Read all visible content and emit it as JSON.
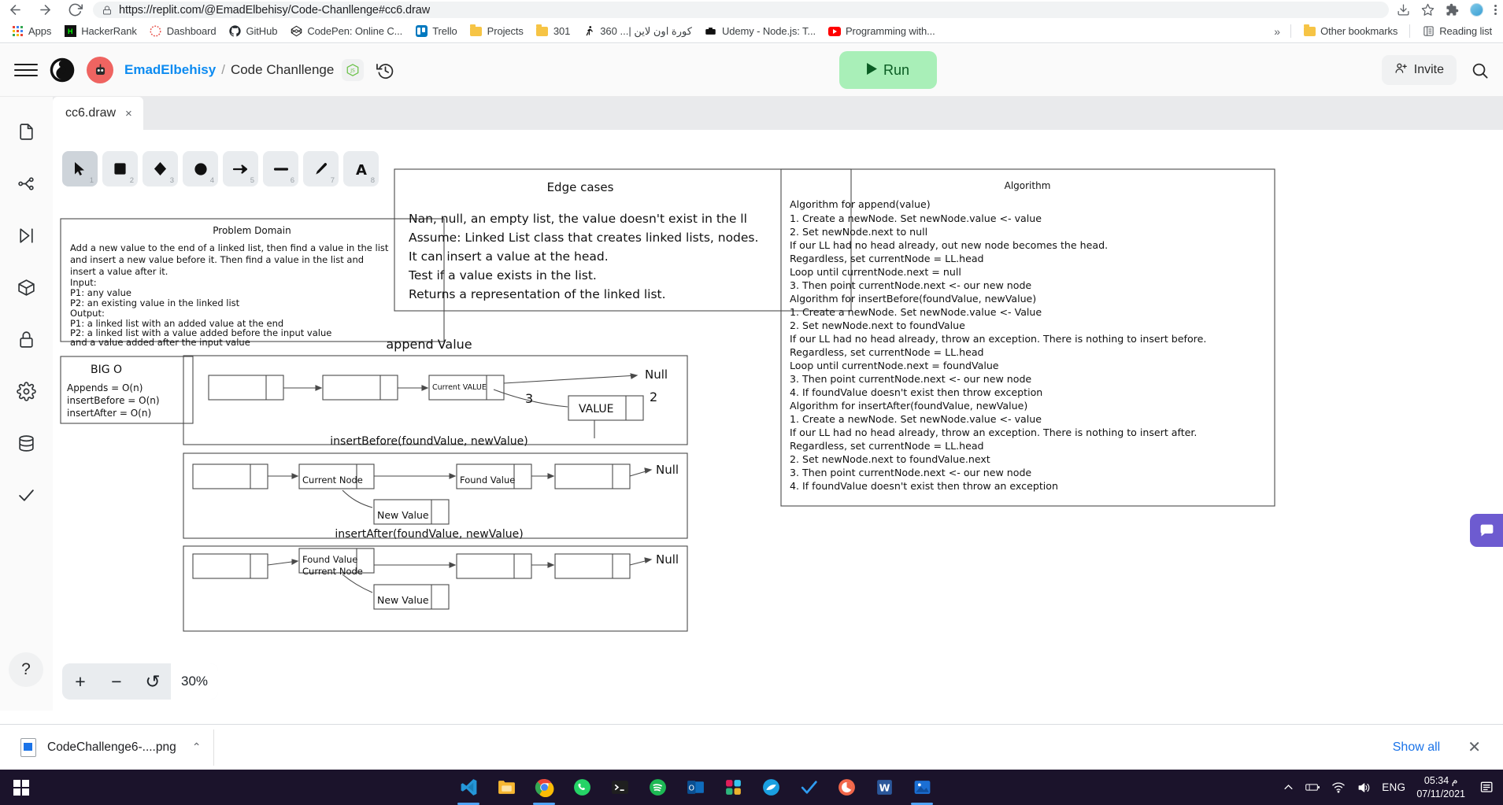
{
  "browser": {
    "url": "https://replit.com/@EmadElbehisy/Code-Chanllenge#cc6.draw",
    "back_label": "Back",
    "forward_label": "Forward",
    "reload_label": "Reload",
    "lock_icon": "lock-icon",
    "install_icon": "install-icon",
    "star_icon": "bookmark-star-icon",
    "extensions_icon": "extensions-puzzle-icon",
    "profile_icon": "profile-avatar",
    "menu_icon": "three-dot-menu-icon"
  },
  "bookmarks": {
    "items": [
      {
        "label": "Apps",
        "icon": "apps-grid-icon"
      },
      {
        "label": "HackerRank",
        "icon": "hackerrank-icon"
      },
      {
        "label": "Dashboard",
        "icon": "dashboard-icon"
      },
      {
        "label": "GitHub",
        "icon": "github-icon"
      },
      {
        "label": "CodePen: Online C...",
        "icon": "codepen-icon"
      },
      {
        "label": "Trello",
        "icon": "trello-icon"
      },
      {
        "label": "Projects",
        "icon": "folder-icon"
      },
      {
        "label": "301",
        "icon": "folder-icon"
      },
      {
        "label": "كورة اون لاين |... 360",
        "icon": "kora-icon"
      },
      {
        "label": "Udemy - Node.js: T...",
        "icon": "udemy-icon"
      },
      {
        "label": "Programming with...",
        "icon": "youtube-icon"
      }
    ],
    "overflow_label": "»",
    "other_bookmarks": {
      "label": "Other bookmarks",
      "icon": "folder-icon"
    },
    "reading_list": {
      "label": "Reading list",
      "icon": "reading-list-icon"
    }
  },
  "replit_header": {
    "menu_icon": "hamburger-menu-icon",
    "logo_icon": "replit-logo-icon",
    "avatar_icon": "user-avatar",
    "user": "EmadElbehisy",
    "separator": "/",
    "project": "Code Chanllenge",
    "language_badge": "nodejs-badge-icon",
    "history_icon": "history-icon",
    "run_label": "Run",
    "run_icon": "play-icon",
    "run_color": "#a9efb8",
    "invite_label": "Invite",
    "invite_icon": "add-person-icon",
    "search_icon": "search-icon"
  },
  "sidebar": {
    "items": [
      {
        "name": "files",
        "icon": "file-icon"
      },
      {
        "name": "version-control",
        "icon": "git-branch-icon"
      },
      {
        "name": "debugger",
        "icon": "play-to-line-icon"
      },
      {
        "name": "packages",
        "icon": "cube-box-icon"
      },
      {
        "name": "secrets",
        "icon": "lock-icon"
      },
      {
        "name": "settings",
        "icon": "gear-icon"
      },
      {
        "name": "database",
        "icon": "database-icon"
      },
      {
        "name": "checks",
        "icon": "checkmark-icon"
      }
    ],
    "help_label": "?"
  },
  "editor": {
    "tab": {
      "label": "cc6.draw",
      "close_label": "×"
    },
    "toolbar": [
      {
        "tool": "selection",
        "num": "1",
        "icon": "cursor-arrow-icon",
        "active": true
      },
      {
        "tool": "rectangle",
        "num": "2",
        "icon": "square-icon",
        "active": false
      },
      {
        "tool": "diamond",
        "num": "3",
        "icon": "diamond-icon",
        "active": false
      },
      {
        "tool": "ellipse",
        "num": "4",
        "icon": "circle-icon",
        "active": false
      },
      {
        "tool": "arrow",
        "num": "5",
        "icon": "arrow-icon",
        "active": false
      },
      {
        "tool": "line",
        "num": "6",
        "icon": "line-icon",
        "active": false
      },
      {
        "tool": "draw",
        "num": "7",
        "icon": "pencil-icon",
        "active": false
      },
      {
        "tool": "text",
        "num": "8",
        "icon": "text-a-icon",
        "active": false
      }
    ],
    "zoom": {
      "out_label": "−",
      "in_label": "+",
      "reset_label": "↺",
      "value": "30%"
    },
    "chat_icon": "chat-bubble-icon"
  },
  "whiteboard": {
    "problem_domain": {
      "title": "Problem Domain",
      "lines": [
        "Add a new value to the end of a linked list, then find a value in the list",
        "and insert a new value before it. Then find a value in the list and",
        "insert a value after it.",
        "Input:",
        "P1: any value",
        "P2: an existing value in the linked list",
        "Output:",
        "P1: a linked list with an added value at the end",
        "P2: a linked list with a value added before the input value",
        "and a value added after the input value"
      ]
    },
    "big_o": {
      "title": "BIG O",
      "lines": [
        "Appends = O(n)",
        "insertBefore = O(n)",
        "insertAfter = O(n)"
      ]
    },
    "edge_cases": {
      "title": "Edge cases",
      "lines": [
        "Nan, null, an empty list, the value doesn't exist in the ll",
        "Assume: Linked List class that creates linked lists, nodes.",
        "It can insert a value at the head.",
        "Test if a value exists in the list.",
        "Returns a representation of the linked list."
      ]
    },
    "algorithm": {
      "title": "Algorithm",
      "lines": [
        "Algorithm for append(value)",
        "1. Create a newNode. Set newNode.value <- value",
        "2. Set newNode.next to null",
        "If our LL had no head already, out new node becomes the head.",
        "Regardless, set currentNode = LL.head",
        "Loop until currentNode.next = null",
        "3. Then point currentNode.next <- our new node",
        "Algorithm for insertBefore(foundValue, newValue)",
        "1. Create a newNode. Set newNode.value <- Value",
        "2. Set newNode.next to foundValue",
        "If our LL had no head already, throw an exception. There is nothing to insert before.",
        "Regardless, set currentNode = LL.head",
        "Loop until currentNode.next = foundValue",
        "3. Then point currentNode.next <- our new node",
        "4. If foundValue doesn't exist then throw exception",
        "Algorithm for insertAfter(foundValue, newValue)",
        "1. Create a newNode. Set newNode.value <- value",
        "If our LL had no head already, throw an exception. There is nothing to insert after.",
        "Regardless, set currentNode = LL.head",
        "2. Set newNode.next to foundValue.next",
        "3. Then point currentNode.next <- our new node",
        "4. If foundValue doesn't exist then throw an exception"
      ]
    },
    "diagrams": [
      {
        "title": "append Value",
        "labels": [
          "Current VALUE",
          "Null",
          "VALUE",
          "3",
          "2"
        ]
      },
      {
        "title": "insertBefore(foundValue, newValue)",
        "labels": [
          "Current Node",
          "Found Value",
          "Null",
          "New Value"
        ]
      },
      {
        "title": "insertAfter(foundValue, newValue)",
        "labels": [
          "Found Value",
          "Current Node",
          "Null",
          "New Value"
        ]
      }
    ]
  },
  "download_bar": {
    "file_name": "CodeChallenge6-....png",
    "caret_label": "⌃",
    "show_all_label": "Show all",
    "close_label": "✕"
  },
  "taskbar": {
    "start_icon": "windows-start-icon",
    "apps": [
      {
        "name": "vscode",
        "icon": "vscode-icon",
        "active": true
      },
      {
        "name": "file-explorer",
        "icon": "folder-explorer-icon",
        "active": false
      },
      {
        "name": "chrome",
        "icon": "chrome-icon",
        "active": true
      },
      {
        "name": "whatsapp",
        "icon": "whatsapp-icon",
        "active": false
      },
      {
        "name": "terminal",
        "icon": "terminal-icon",
        "active": false
      },
      {
        "name": "spotify",
        "icon": "spotify-icon",
        "active": false
      },
      {
        "name": "outlook",
        "icon": "outlook-icon",
        "active": false
      },
      {
        "name": "slack",
        "icon": "slack-icon",
        "active": false
      },
      {
        "name": "postman",
        "icon": "postman-icon",
        "active": false
      },
      {
        "name": "todoist",
        "icon": "todoist-check-icon",
        "active": false
      },
      {
        "name": "firefox",
        "icon": "browser-icon",
        "active": false
      },
      {
        "name": "word",
        "icon": "word-icon",
        "active": false
      },
      {
        "name": "photos",
        "icon": "photos-icon",
        "active": true
      }
    ],
    "tray": {
      "chevron": "show-hidden-icons",
      "battery_icon": "battery-icon",
      "wifi_icon": "wifi-icon",
      "volume_icon": "volume-icon",
      "language": "ENG",
      "time": "05:34 م",
      "date": "07/11/2021",
      "notification_icon": "notification-icon"
    }
  }
}
